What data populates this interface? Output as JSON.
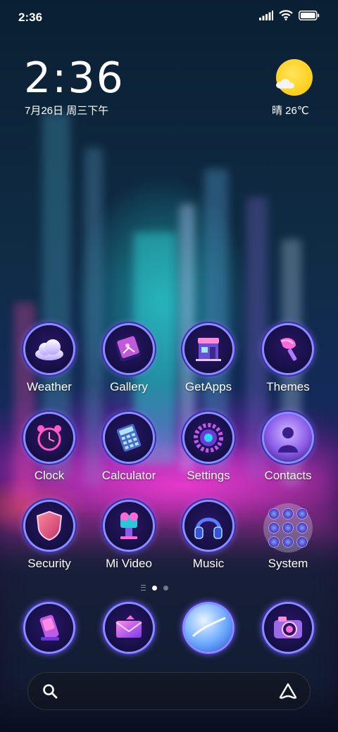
{
  "status_bar": {
    "time": "2:36"
  },
  "clock_widget": {
    "time": "2:36",
    "date": "7月26日 周三下午"
  },
  "weather_widget": {
    "condition_temp": "晴 26℃"
  },
  "apps": [
    {
      "label": "Weather",
      "icon": "weather-cloud-icon"
    },
    {
      "label": "Gallery",
      "icon": "gallery-book-icon"
    },
    {
      "label": "GetApps",
      "icon": "getapps-store-icon"
    },
    {
      "label": "Themes",
      "icon": "themes-brush-icon"
    },
    {
      "label": "Clock",
      "icon": "alarm-clock-icon"
    },
    {
      "label": "Calculator",
      "icon": "calculator-icon"
    },
    {
      "label": "Settings",
      "icon": "settings-gear-icon"
    },
    {
      "label": "Contacts",
      "icon": "contacts-person-icon"
    },
    {
      "label": "Security",
      "icon": "security-shield-icon"
    },
    {
      "label": "Mi Video",
      "icon": "video-camera-icon"
    },
    {
      "label": "Music",
      "icon": "headphones-icon"
    },
    {
      "label": "System",
      "icon": "system-folder-icon"
    }
  ],
  "dock": [
    {
      "icon": "phone-icon"
    },
    {
      "icon": "messages-envelope-icon"
    },
    {
      "icon": "browser-planet-icon"
    },
    {
      "icon": "camera-icon"
    }
  ],
  "page_indicator": {
    "pages": 2,
    "active": 1
  },
  "colors": {
    "ring": "#8a8cff",
    "accent_pink": "#ff3cdc",
    "accent_cyan": "#28e6e6",
    "sun": "#ffc400"
  }
}
